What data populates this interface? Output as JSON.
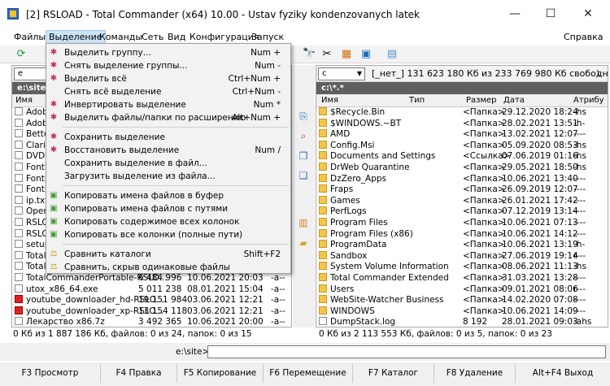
{
  "window": {
    "title": "[2] RSLOAD - Total Commander (x64) 10.00 - Ustav fyziky kondenzovanych latek",
    "minimize": "—",
    "maximize": "☐",
    "close": "✕"
  },
  "menubar": {
    "items": [
      "Файлы",
      "Выделение",
      "Команды",
      "Сеть",
      "Вид",
      "Конфигурация",
      "Запуск"
    ],
    "help": "Справка"
  },
  "toolbar": {
    "icons": [
      "refresh-icon",
      "binoculars-icon",
      "tools-icon",
      "tree-icon",
      "archive-icon",
      "notepad-icon"
    ]
  },
  "left_panel": {
    "drive": "e",
    "path": "e:\\site\\",
    "header": {
      "name": "Имя"
    },
    "files": [
      {
        "name": "Adobe",
        "ext": "",
        "size": "",
        "date": "",
        "attr": "",
        "type": "app"
      },
      {
        "name": "Adobe",
        "ext": "",
        "size": "",
        "date": "",
        "attr": "",
        "type": "app"
      },
      {
        "name": "Better",
        "ext": "",
        "size": "",
        "date": "",
        "attr": "",
        "type": "app"
      },
      {
        "name": "Claris",
        "ext": "",
        "size": "",
        "date": "",
        "attr": "",
        "type": "app"
      },
      {
        "name": "DVDF",
        "ext": "",
        "size": "",
        "date": "",
        "attr": "",
        "type": "app"
      },
      {
        "name": "FontE",
        "ext": "",
        "size": "",
        "date": "",
        "attr": "",
        "type": "app"
      },
      {
        "name": "FontE",
        "ext": "",
        "size": "",
        "date": "",
        "attr": "",
        "type": "app"
      },
      {
        "name": "FontE",
        "ext": "",
        "size": "",
        "date": "",
        "attr": "",
        "type": "app"
      },
      {
        "name": "ip.txt",
        "ext": "",
        "size": "",
        "date": "",
        "attr": "",
        "type": "file"
      },
      {
        "name": "Open",
        "ext": "",
        "size": "",
        "date": "",
        "attr": "",
        "type": "app"
      },
      {
        "name": "RSLO",
        "ext": "",
        "size": "",
        "date": "",
        "attr": "",
        "type": "app"
      },
      {
        "name": "RSLO",
        "ext": "",
        "size": "",
        "date": "",
        "attr": "",
        "type": "app"
      },
      {
        "name": "setup",
        "ext": "",
        "size": "",
        "date": "",
        "attr": "",
        "type": "app"
      },
      {
        "name": "Total",
        "ext": "",
        "size": "",
        "date": "",
        "attr": "",
        "type": "app"
      },
      {
        "name": "Total",
        "ext": "",
        "size": "",
        "date": "",
        "attr": "",
        "type": "app"
      },
      {
        "name": "TotalCommanderPortable-RSLO...",
        "ext": "",
        "size": "6 484 996",
        "date": "10.06.2021 20:03",
        "attr": "-a--",
        "type": "app"
      },
      {
        "name": "utox_x86_64.exe",
        "ext": "",
        "size": "5 011 238",
        "date": "08.01.2021 15:04",
        "attr": "-a--",
        "type": "app"
      },
      {
        "name": "youtube_downloader_hd-RSLO...",
        "ext": "",
        "size": "19 151 984",
        "date": "03.06.2021 12:21",
        "attr": "-a--",
        "type": "red"
      },
      {
        "name": "youtube_downloader_xp-RSLO...",
        "ext": "",
        "size": "13 154 118",
        "date": "03.06.2021 12:21",
        "attr": "-a--",
        "type": "red"
      },
      {
        "name": "Лекарство x86.7z",
        "ext": "",
        "size": "3 492 365",
        "date": "10.06.2021 20:00",
        "attr": "-a--",
        "type": "file"
      }
    ],
    "status": "0 Кб из 1 887 186 Кб, файлов: 0 из 24, папок: 0 из 15"
  },
  "right_panel": {
    "drive": "c",
    "drive_info": "[_нет_]  131 623 180 Кб из 233 769 980 Кб свободно",
    "path_extra": "\\",
    "path": "c:\\*.*",
    "header": {
      "name": "Имя",
      "type": "Тип",
      "size": "Размер",
      "date": "Дата",
      "attr": "Атрибу"
    },
    "files": [
      {
        "name": "$Recycle.Bin",
        "size": "<Папка>",
        "date": "29.12.2020 18:24",
        "attr": "-hs",
        "type": "folder"
      },
      {
        "name": "$WINDOWS.~BT",
        "size": "<Папка>",
        "date": "28.02.2021 13:51",
        "attr": "-h-",
        "type": "folder"
      },
      {
        "name": "AMD",
        "size": "<Папка>",
        "date": "13.02.2021 12:07",
        "attr": "----",
        "type": "folder"
      },
      {
        "name": "Config.Msi",
        "size": "<Папка>",
        "date": "05.09.2020 08:53",
        "attr": "-hs",
        "type": "folder"
      },
      {
        "name": "Documents and Settings",
        "size": "<Ссылка>",
        "date": "07.06.2019 01:16",
        "attr": "-hs",
        "type": "folder"
      },
      {
        "name": "DrWeb Quarantine",
        "size": "<Папка>",
        "date": "29.05.2021 18:50",
        "attr": "-hs",
        "type": "folder"
      },
      {
        "name": "DzZero_Apps",
        "size": "<Папка>",
        "date": "10.06.2021 13:40",
        "attr": "----",
        "type": "folder"
      },
      {
        "name": "Fraps",
        "size": "<Папка>",
        "date": "26.09.2019 12:07",
        "attr": "----",
        "type": "folder"
      },
      {
        "name": "Games",
        "size": "<Папка>",
        "date": "26.01.2021 17:42",
        "attr": "----",
        "type": "folder"
      },
      {
        "name": "PerfLogs",
        "size": "<Папка>",
        "date": "07.12.2019 13:14",
        "attr": "----",
        "type": "folder"
      },
      {
        "name": "Program Files",
        "size": "<Папка>",
        "date": "10.06.2021 07:13",
        "attr": "----",
        "type": "folder"
      },
      {
        "name": "Program Files (x86)",
        "size": "<Папка>",
        "date": "10.06.2021 14:12",
        "attr": "----",
        "type": "folder"
      },
      {
        "name": "ProgramData",
        "size": "<Папка>",
        "date": "10.06.2021 13:19",
        "attr": "-h-",
        "type": "folder"
      },
      {
        "name": "Sandbox",
        "size": "<Папка>",
        "date": "27.06.2019 19:14",
        "attr": "r---",
        "type": "folder"
      },
      {
        "name": "System Volume Information",
        "size": "<Папка>",
        "date": "08.06.2021 11:13",
        "attr": "-hs",
        "type": "folder"
      },
      {
        "name": "Total Commander Extended",
        "size": "<Папка>",
        "date": "31.03.2021 13:28",
        "attr": "----",
        "type": "folder"
      },
      {
        "name": "Users",
        "size": "<Папка>",
        "date": "09.01.2021 08:06",
        "attr": "r---",
        "type": "folder"
      },
      {
        "name": "WebSite-Watcher Business",
        "size": "<Папка>",
        "date": "14.02.2020 07:08",
        "attr": "----",
        "type": "folder"
      },
      {
        "name": "WINDOWS",
        "size": "<Папка>",
        "date": "10.06.2021 14:09",
        "attr": "----",
        "type": "folder"
      },
      {
        "name": "DumpStack.log",
        "size": "8 192",
        "date": "28.01.2021 09:03",
        "attr": "-ahs",
        "type": "file"
      }
    ],
    "status": "0 Кб из 2 113 553 Кб, файлов: 0 из 5, папок: 0 из 23"
  },
  "command_line": {
    "label": "e:\\site>",
    "value": ""
  },
  "fkeys": [
    "F3 Просмотр",
    "F4 Правка",
    "F5 Копирование",
    "F6 Перемещение",
    "F7 Каталог",
    "F8 Удаление",
    "Alt+F4 Выход"
  ],
  "selection_menu": {
    "items": [
      {
        "label": "Выделить группу...",
        "shortcut": "Num +",
        "icon": "select-group-icon"
      },
      {
        "label": "Снять выделение группы...",
        "shortcut": "Num -",
        "icon": "unselect-group-icon"
      },
      {
        "label": "Выделить всё",
        "shortcut": "Ctrl+Num +",
        "icon": "select-all-icon"
      },
      {
        "label": "Снять всё выделение",
        "shortcut": "Ctrl+Num -",
        "icon": ""
      },
      {
        "label": "Инвертировать выделение",
        "shortcut": "Num *",
        "icon": "invert-selection-icon"
      },
      {
        "label": "Выделить файлы/папки по расширению",
        "shortcut": "Alt+Num +",
        "icon": "select-by-ext-icon"
      },
      {
        "label": "Сохранить выделение",
        "shortcut": "",
        "icon": "save-selection-icon"
      },
      {
        "label": "Восстановить выделение",
        "shortcut": "Num /",
        "icon": "restore-selection-icon"
      },
      {
        "label": "Сохранить выделение в файл...",
        "shortcut": "",
        "icon": ""
      },
      {
        "label": "Загрузить выделение из файла...",
        "shortcut": "",
        "icon": ""
      },
      {
        "label": "Копировать имена файлов в буфер",
        "shortcut": "",
        "icon": "copy-names-icon"
      },
      {
        "label": "Копировать имена файлов с путями",
        "shortcut": "",
        "icon": "copy-paths-icon"
      },
      {
        "label": "Копировать содержимое всех колонок",
        "shortcut": "",
        "icon": "copy-columns-icon"
      },
      {
        "label": "Копировать все колонки (полные пути)",
        "shortcut": "",
        "icon": "copy-all-columns-icon"
      },
      {
        "label": "Сравнить каталоги",
        "shortcut": "Shift+F2",
        "icon": "compare-dirs-icon"
      },
      {
        "label": "Сравнить, скрыв одинаковые файлы",
        "shortcut": "",
        "icon": "compare-hide-icon"
      }
    ]
  },
  "colors": {
    "accent": "#cce4f7",
    "path_bar": "#5f5f5f",
    "folder": "#f3c647",
    "red_icon": "#d22222"
  }
}
